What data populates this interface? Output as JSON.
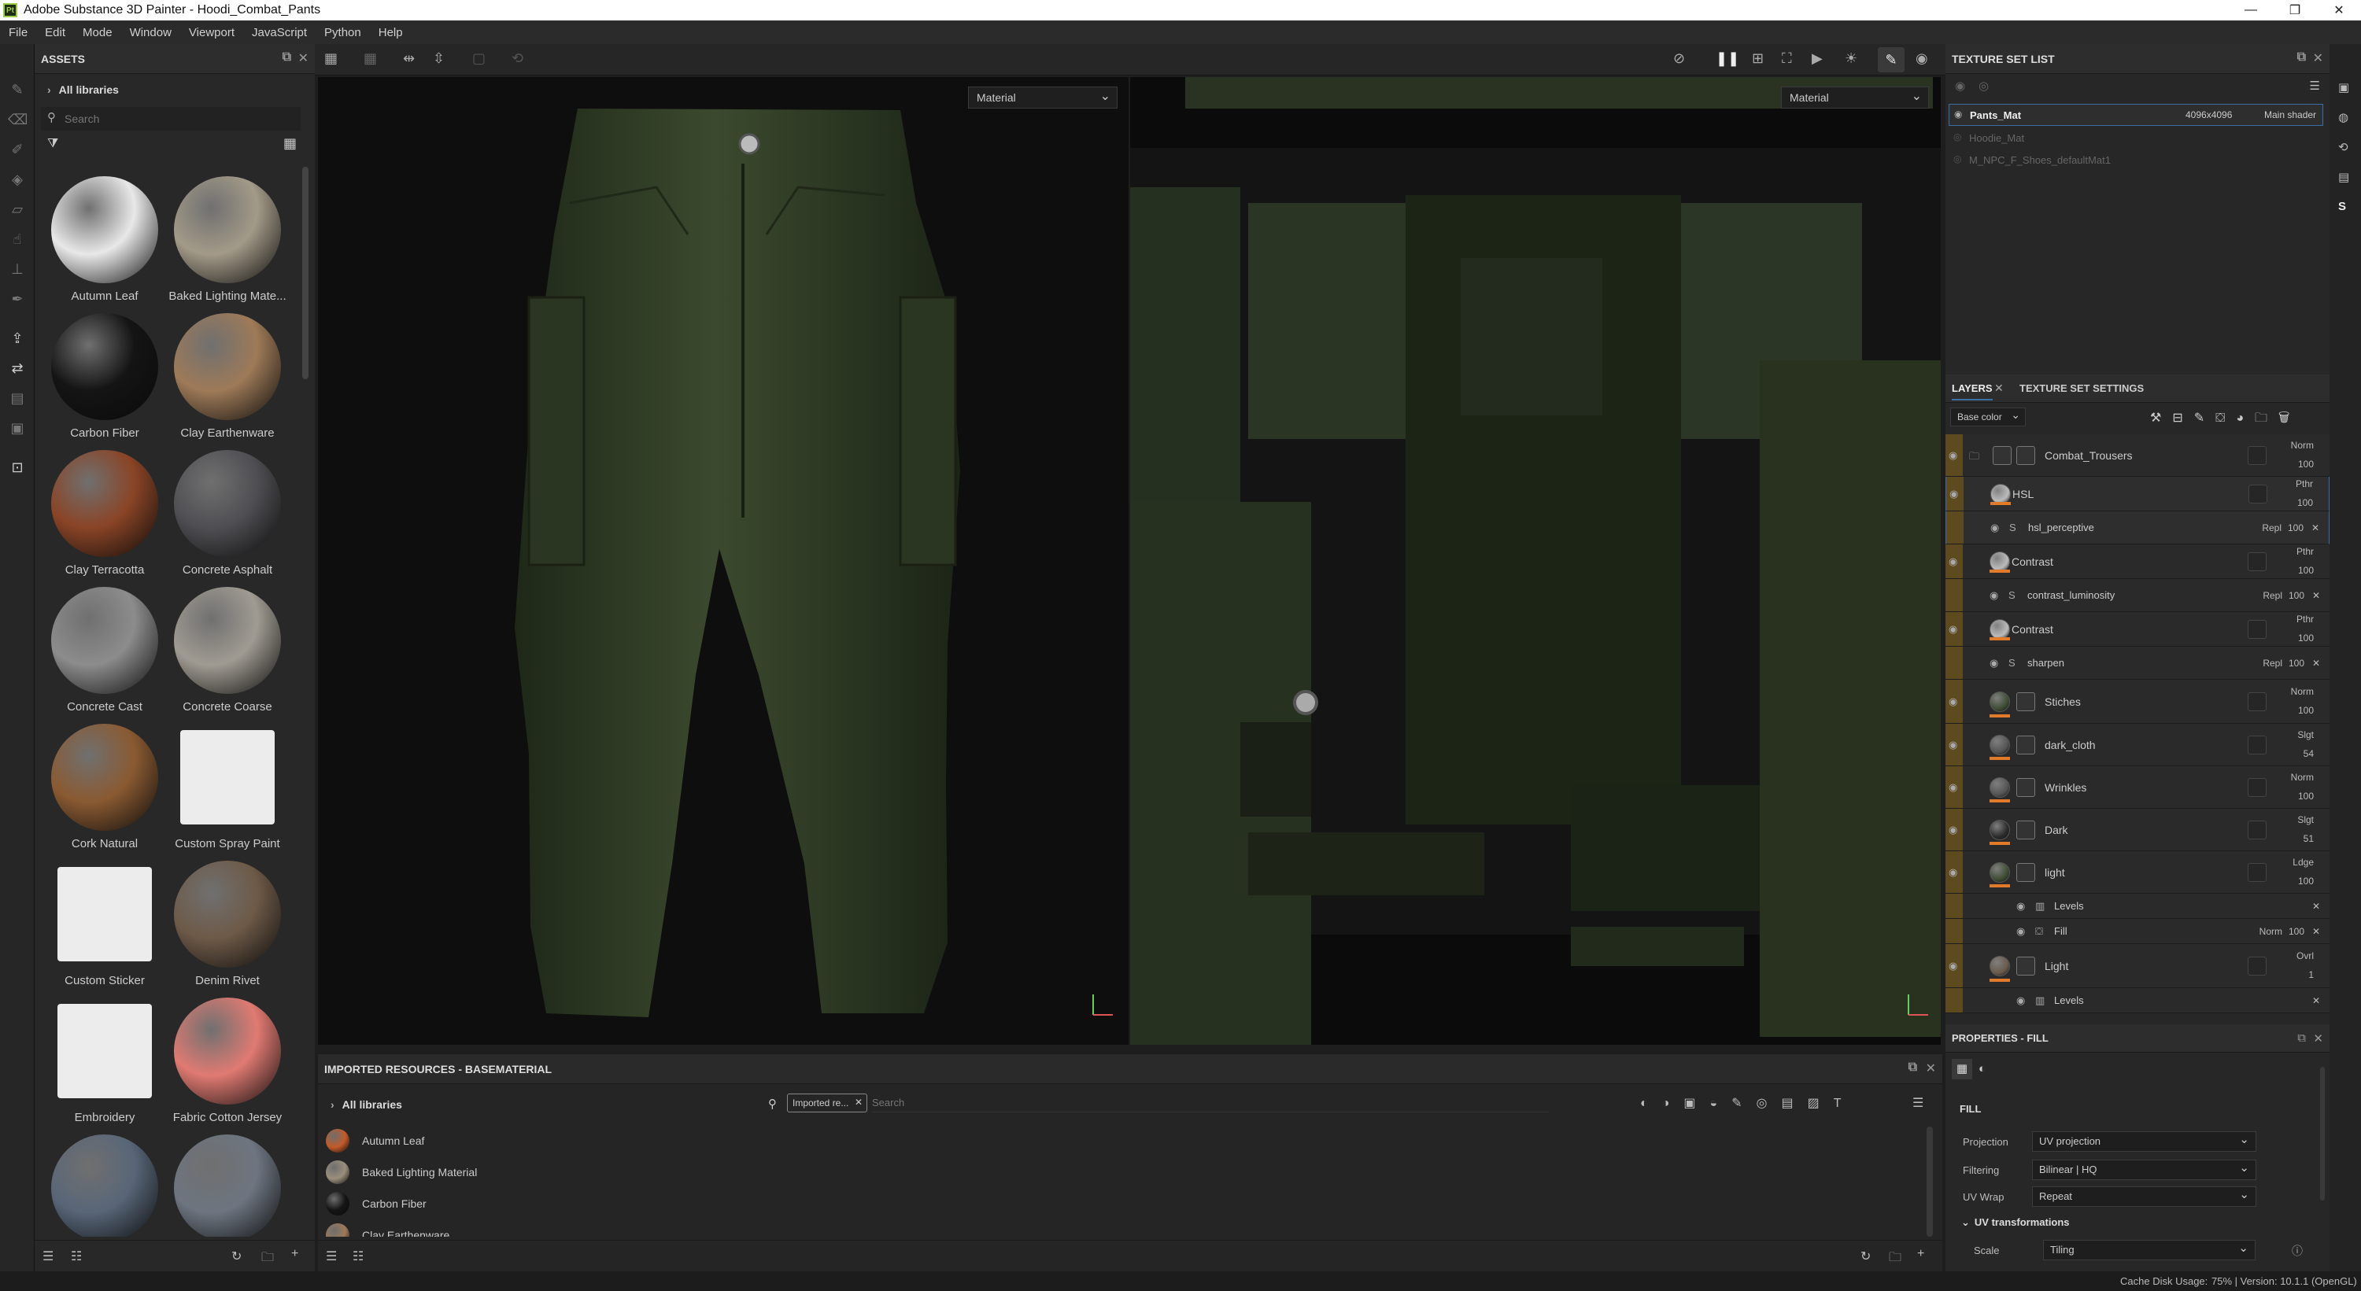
{
  "app": {
    "title": "Adobe Substance 3D Painter - Hoodi_Combat_Pants",
    "logo": "Pt"
  },
  "menu": [
    "File",
    "Edit",
    "Mode",
    "Window",
    "Viewport",
    "JavaScript",
    "Python",
    "Help"
  ],
  "assets": {
    "title": "ASSETS",
    "breadcrumb": "All libraries",
    "search_placeholder": "Search",
    "items": [
      {
        "name": "Autumn Leaf",
        "color": "#e8e8e8"
      },
      {
        "name": "Baked Lighting Mate...",
        "color": "#a39a88"
      },
      {
        "name": "Carbon Fiber",
        "color": "#141414"
      },
      {
        "name": "Clay Earthenware",
        "color": "#9e7a58"
      },
      {
        "name": "Clay Terracotta",
        "color": "#8a4426"
      },
      {
        "name": "Concrete Asphalt",
        "color": "#4f4f53"
      },
      {
        "name": "Concrete Cast",
        "color": "#8c8c8c"
      },
      {
        "name": "Concrete Coarse",
        "color": "#a09b92"
      },
      {
        "name": "Cork Natural",
        "color": "#8a5a32"
      },
      {
        "name": "Custom Spray Paint",
        "color": "#ececec"
      },
      {
        "name": "Custom Sticker",
        "color": "#ececec"
      },
      {
        "name": "Denim Rivet",
        "color": "#6e5a48"
      },
      {
        "name": "Embroidery",
        "color": "#ececec"
      },
      {
        "name": "Fabric Cotton Jersey",
        "color": "#e07a72"
      },
      {
        "name": "",
        "color": "#586678"
      },
      {
        "name": "",
        "color": "#6d7580"
      }
    ]
  },
  "viewport": {
    "view3d_mode": "Material",
    "view2d_mode": "Material"
  },
  "imported": {
    "title": "IMPORTED RESOURCES - BASEMATERIAL",
    "breadcrumb": "All libraries",
    "filter_chip": "Imported re...",
    "search_placeholder": "Search",
    "items": [
      {
        "name": "Autumn Leaf",
        "color": "#c25a2a"
      },
      {
        "name": "Baked Lighting Material",
        "color": "#9a8f7c"
      },
      {
        "name": "Carbon Fiber",
        "color": "#151515"
      },
      {
        "name": "Clay Earthenware",
        "color": "#9e7a58"
      }
    ]
  },
  "texture_sets": {
    "title": "TEXTURE SET LIST",
    "items": [
      {
        "name": "Pants_Mat",
        "size": "4096x4096",
        "shader": "Main shader"
      },
      {
        "name": "Hoodie_Mat",
        "size": "",
        "shader": ""
      },
      {
        "name": "M_NPC_F_Shoes_defaultMat1",
        "size": "",
        "shader": ""
      }
    ]
  },
  "layers": {
    "tab_layers": "LAYERS",
    "tab_settings": "TEXTURE SET SETTINGS",
    "channel": "Base color",
    "rows": [
      {
        "name": "Combat_Trousers",
        "blend": "Norm",
        "opacity": "100"
      },
      {
        "name": "HSL",
        "blend": "Pthr",
        "opacity": "100"
      },
      {
        "name": "hsl_perceptive",
        "blend": "Repl",
        "opacity": "100"
      },
      {
        "name": "Contrast",
        "blend": "Pthr",
        "opacity": "100"
      },
      {
        "name": "contrast_luminosity",
        "blend": "Repl",
        "opacity": "100"
      },
      {
        "name": "Contrast",
        "blend": "Pthr",
        "opacity": "100"
      },
      {
        "name": "sharpen",
        "blend": "Repl",
        "opacity": "100"
      },
      {
        "name": "Stiches",
        "blend": "Norm",
        "opacity": "100"
      },
      {
        "name": "dark_cloth",
        "blend": "Slgt",
        "opacity": "54"
      },
      {
        "name": "Wrinkles",
        "blend": "Norm",
        "opacity": "100"
      },
      {
        "name": "Dark",
        "blend": "Slgt",
        "opacity": "51"
      },
      {
        "name": "light",
        "blend": "Ldge",
        "opacity": "100"
      },
      {
        "name": "Levels",
        "blend": "",
        "opacity": ""
      },
      {
        "name": "Fill",
        "blend": "Norm",
        "opacity": "100"
      },
      {
        "name": "Light",
        "blend": "Ovrl",
        "opacity": "1"
      },
      {
        "name": "Levels",
        "blend": "",
        "opacity": ""
      }
    ]
  },
  "properties": {
    "title": "PROPERTIES - FILL",
    "section": "FILL",
    "projection_label": "Projection",
    "projection": "UV projection",
    "filtering_label": "Filtering",
    "filtering": "Bilinear | HQ",
    "uvwrap_label": "UV Wrap",
    "uvwrap": "Repeat",
    "uvtrans": "UV transformations",
    "scale_label": "Scale",
    "scale": "Tiling"
  },
  "status": {
    "cache": "Cache Disk Usage:",
    "info": "75% | Version: 10.1.1 (OpenGL)"
  },
  "colors": {
    "accent": "#e07b2a",
    "selection": "#3a6ea5",
    "layer_band": "#5e4a1f"
  }
}
